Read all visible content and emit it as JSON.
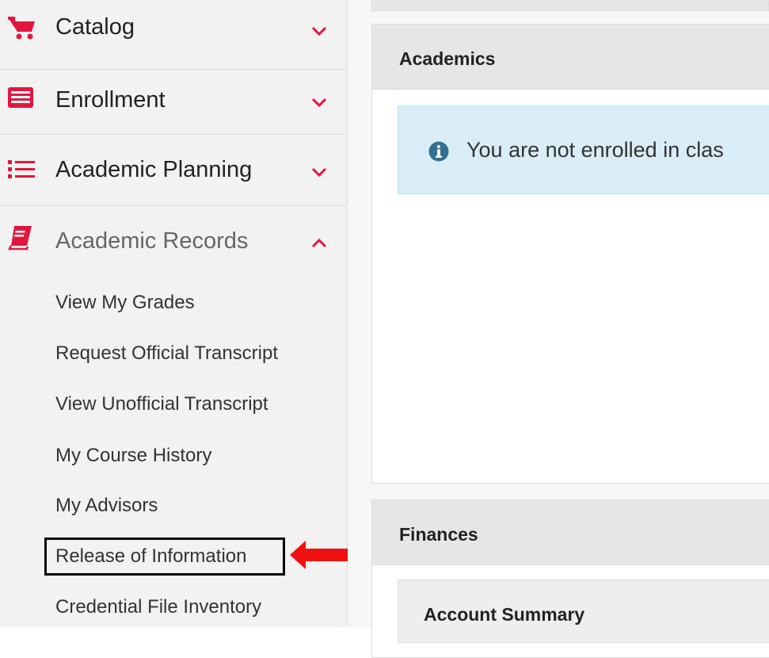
{
  "sidebar": {
    "menu": [
      {
        "label": "Catalog",
        "icon": "shopping-cart-icon",
        "expanded": false
      },
      {
        "label": "Enrollment",
        "icon": "list-alt-icon",
        "expanded": false
      },
      {
        "label": "Academic Planning",
        "icon": "list-icon",
        "expanded": false
      },
      {
        "label": "Academic Records",
        "icon": "book-icon",
        "expanded": true
      }
    ],
    "subitems": [
      "View My Grades",
      "Request Official Transcript",
      "View Unofficial Transcript",
      "My Course History",
      "My Advisors",
      "Release of Information",
      "Credential File Inventory"
    ]
  },
  "main": {
    "academics": {
      "title": "Academics",
      "alert_text": "You are not enrolled in clas"
    },
    "finances": {
      "title": "Finances",
      "account_summary_title": "Account Summary"
    }
  },
  "colors": {
    "accent_red": "#e3163d",
    "sidebar_bg": "#f2f2f2",
    "panel_header_bg": "#e6e6e6",
    "alert_bg": "#d9edf7",
    "info_icon": "#31708f"
  }
}
